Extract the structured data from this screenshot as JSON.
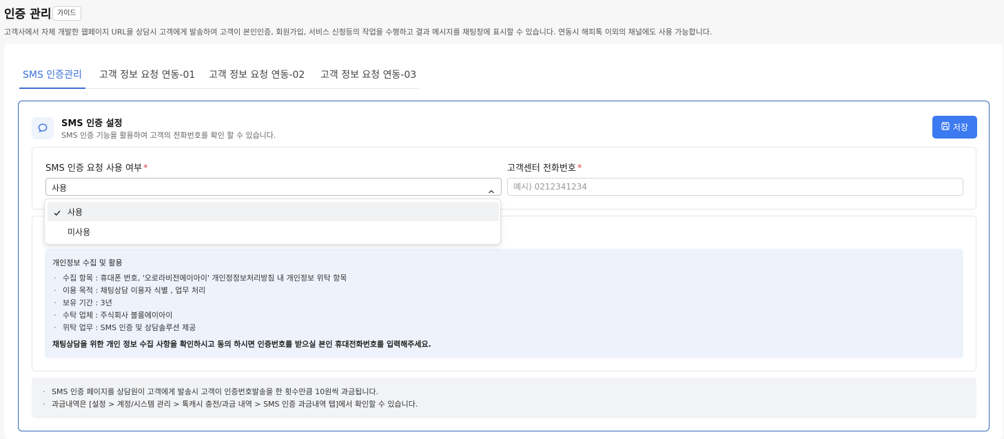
{
  "page": {
    "title": "인증 관리",
    "guide_label": "가이드",
    "description": "고객사에서 자체 개발한 웹페이지 URL을 상담시 고객에게 발송하여 고객이 본인인증, 회원가입, 서비스 신청등의 작업을 수행하고 결과 메시지를 채팅창에 표시할 수 있습니다. 연동시 해피톡 이외의 채널에도 사용 가능합니다."
  },
  "tabs": [
    {
      "label": "SMS 인증관리",
      "active": true
    },
    {
      "label": "고객 정보 요청 연동-01",
      "active": false
    },
    {
      "label": "고객 정보 요청 연동-02",
      "active": false
    },
    {
      "label": "고객 정보 요청 연동-03",
      "active": false
    }
  ],
  "section": {
    "icon": "chat-bubble-icon",
    "title": "SMS 인증 설정",
    "description": "SMS 인증 기능을 활용하여 고객의 전화번호를 확인 할 수 있습니다.",
    "save_label": "저장"
  },
  "form": {
    "usage_label": "SMS 인증 요청 사용 여부",
    "usage_value": "사용",
    "usage_options": [
      "사용",
      "미사용"
    ],
    "phone_label": "고객센터 전화번호",
    "phone_placeholder": "예시) 0212341234",
    "required_mark": "*"
  },
  "consent": {
    "title": "개인정보 수집 및 활용",
    "items": [
      "수집 항목 : 휴대폰 번호, '오로라비전에이아이' 개인정정보처리방침 내 개인정보 위탁 항목",
      "이용 목적 : 채팅상담 이용자 식별 , 업무 처리",
      "보유 기간 : 3년",
      "수탁 업체 : 주식회사 블룸에이아이",
      "위탁 업무 : SMS 인증 및 상담솔루션 제공"
    ],
    "footer": "채팅상담을 위한 개인 정보 수집 사항을 확인하시고 동의 하시면 인증번호를 받으실 본인 휴대전화번호를 입력해주세요."
  },
  "notes": [
    "SMS 인증 페이지를 상담원이 고객에게 발송시 고객이 인증번호발송을 한 횟수만큼 10원씩 과금됩니다.",
    "과금내역은 [설정 > 계정/시스템 관리 > 톡캐시 충전/과금 내역 > SMS 인증 과금내역 탭]에서 확인할 수 있습니다."
  ],
  "colors": {
    "accent": "#3b6fd8",
    "save_button": "#3b7af0",
    "panel_border": "#3366b3",
    "required": "#e23b3b",
    "info_background": "#eef2fb"
  }
}
